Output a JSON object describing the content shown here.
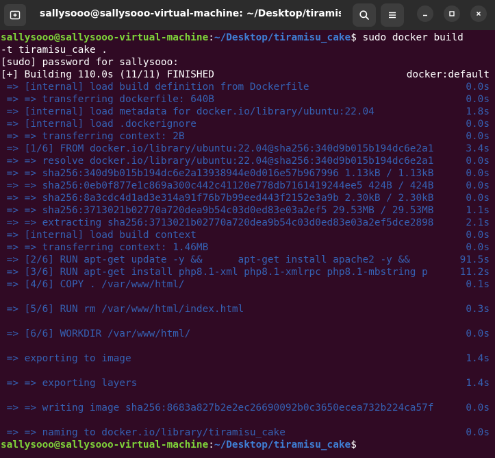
{
  "window": {
    "title": "sallysooo@sallysooo-virtual-machine: ~/Desktop/tiramisu_c..."
  },
  "prompt": {
    "userhost": "sallysooo@sallysooo-virtual-machine",
    "sep": ":",
    "path": "~/Desktop/tiramisu_cake",
    "sym": "$"
  },
  "cmd": {
    "part1": " sudo docker build",
    "part2": "-t tiramisu_cake ."
  },
  "output": {
    "sudo_prompt": "[sudo] password for sallysooo:",
    "building": "[+] Building 110.0s (11/11) FINISHED",
    "builder": "docker:default",
    "steps": [
      {
        "text": " => [internal] load build definition from Dockerfile",
        "time": "0.0s"
      },
      {
        "text": " => => transferring dockerfile: 640B",
        "time": "0.0s"
      },
      {
        "text": " => [internal] load metadata for docker.io/library/ubuntu:22.04",
        "time": "1.8s"
      },
      {
        "text": " => [internal] load .dockerignore",
        "time": "0.0s"
      },
      {
        "text": " => => transferring context: 2B",
        "time": "0.0s"
      },
      {
        "text": " => [1/6] FROM docker.io/library/ubuntu:22.04@sha256:340d9b015b194dc6e2a1",
        "time": "3.4s"
      },
      {
        "text": " => => resolve docker.io/library/ubuntu:22.04@sha256:340d9b015b194dc6e2a1",
        "time": "0.0s"
      },
      {
        "text": " => => sha256:340d9b015b194dc6e2a13938944e0d016e57b967996 1.13kB / 1.13kB",
        "time": "0.0s"
      },
      {
        "text": " => => sha256:0eb0f877e1c869a300c442c41120e778db7161419244ee5 424B / 424B",
        "time": "0.0s"
      },
      {
        "text": " => => sha256:8a3cdc4d1ad3e314a91f76b7b99eed443f2152e3a9b 2.30kB / 2.30kB",
        "time": "0.0s"
      },
      {
        "text": " => => sha256:3713021b02770a720dea9b54c03d0ed83e03a2ef5 29.53MB / 29.53MB",
        "time": "1.1s"
      },
      {
        "text": " => => extracting sha256:3713021b02770a720dea9b54c03d0ed83e03a2ef5dce2898",
        "time": "2.1s"
      },
      {
        "text": " => [internal] load build context",
        "time": "0.0s"
      },
      {
        "text": " => => transferring context: 1.46MB",
        "time": "0.0s"
      },
      {
        "text": " => [2/6] RUN apt-get update -y &&      apt-get install apache2 -y &&",
        "time": "91.5s"
      },
      {
        "text": " => [3/6] RUN apt-get install php8.1-xml php8.1-xmlrpc php8.1-mbstring p",
        "time": "11.2s"
      },
      {
        "text": " => [4/6] COPY . /var/www/html/",
        "time": "0.1s"
      },
      {
        "text": " => [5/6] RUN rm /var/www/html/index.html",
        "time": "0.3s"
      },
      {
        "text": " => [6/6] WORKDIR /var/www/html/",
        "time": "0.0s"
      },
      {
        "text": " => exporting to image",
        "time": "1.4s"
      },
      {
        "text": " => => exporting layers",
        "time": "1.4s"
      },
      {
        "text": " => => writing image sha256:8683a827b2e2ec26690092b0c3650ecea732b224ca57f",
        "time": "0.0s"
      },
      {
        "text": " => => naming to docker.io/library/tiramisu_cake",
        "time": "0.0s"
      }
    ]
  },
  "icons": {
    "new_tab": "new-tab-icon",
    "search": "search-icon",
    "menu": "hamburger-menu-icon",
    "minimize": "minimize-icon",
    "maximize": "maximize-icon",
    "close": "close-icon"
  },
  "colors": {
    "background": "#300a24",
    "titlebar": "#2c2c2c",
    "prompt_user": "#7fd43a",
    "prompt_path": "#3f7fd6",
    "dim_output": "#3561b3",
    "text": "#ffffff"
  }
}
